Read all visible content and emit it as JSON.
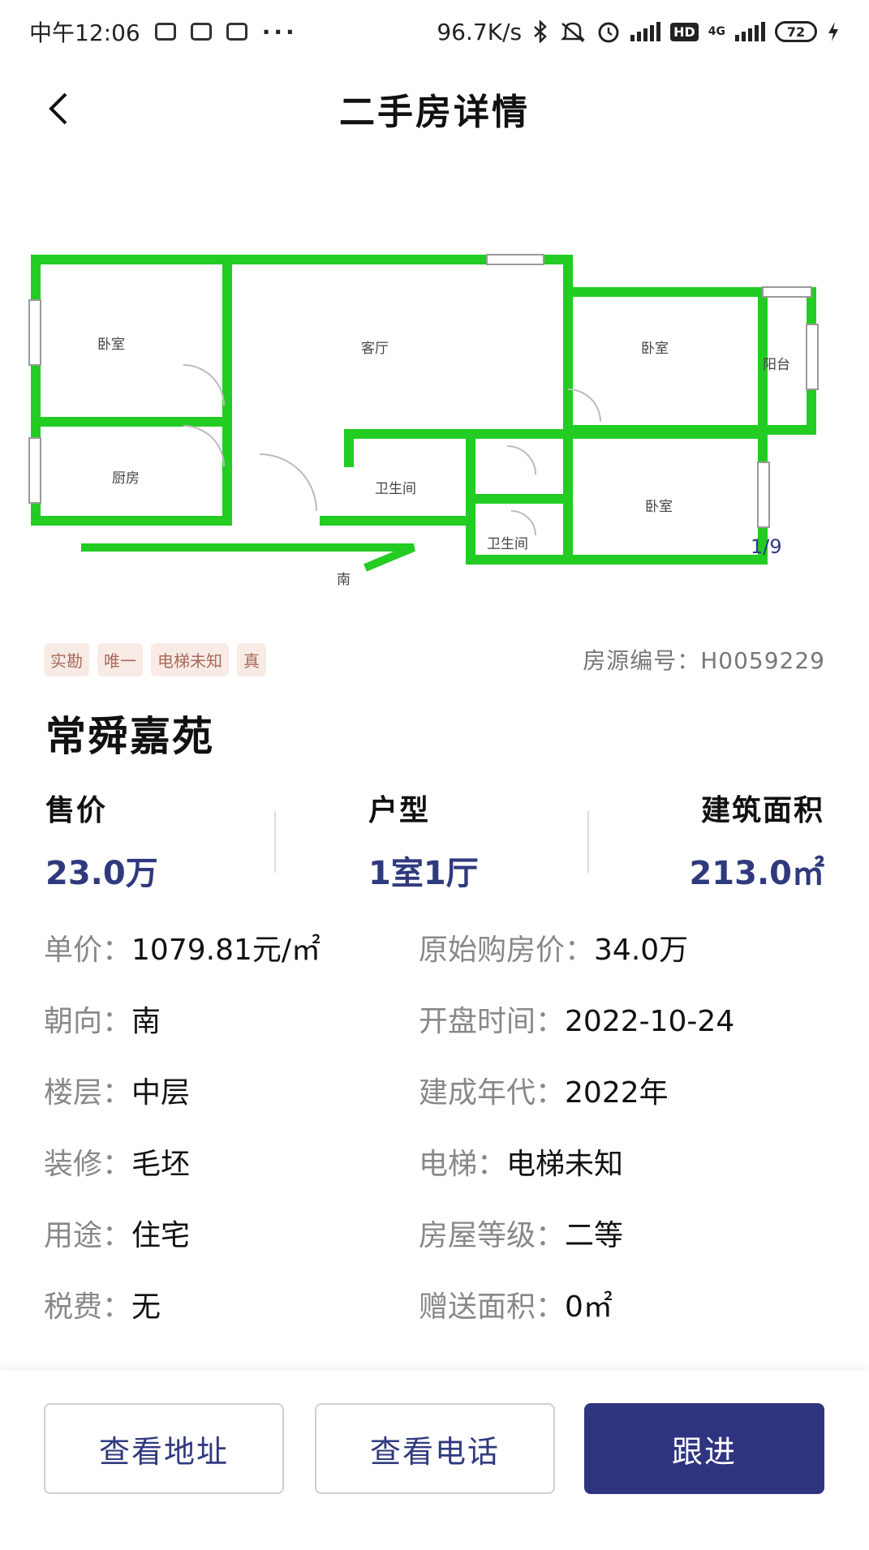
{
  "status_bar": {
    "time": "中午12:06",
    "more": "···",
    "net_speed": "96.7K/s",
    "hd": "HD",
    "network": "4G",
    "battery": "72"
  },
  "header": {
    "title": "二手房详情"
  },
  "photo": {
    "counter": "1/9",
    "floorplan_labels": {
      "bedroom1": "卧室",
      "living": "客厅",
      "bedroom2": "卧室",
      "balcony": "阳台",
      "kitchen": "厨房",
      "bath1": "卫生间",
      "bath2": "卫生间",
      "bedroom3": "卧室",
      "south": "南"
    },
    "plan_color": "#22cc22"
  },
  "tags": [
    "实勘",
    "唯一",
    "电梯未知",
    "真"
  ],
  "house_code": "房源编号：H0059229",
  "estate_name": "常舜嘉苑",
  "stats": {
    "price_label": "售价",
    "price_value": "23.0万",
    "layout_label": "户型",
    "layout_value": "1室1厅",
    "area_label": "建筑面积",
    "area_value": "213.0㎡"
  },
  "details": [
    {
      "lk": "单价：",
      "lv": "1079.81元/㎡",
      "rk": "原始购房价：",
      "rv": "34.0万"
    },
    {
      "lk": "朝向：",
      "lv": "南",
      "rk": "开盘时间：",
      "rv": "2022-10-24"
    },
    {
      "lk": "楼层：",
      "lv": "中层",
      "rk": "建成年代：",
      "rv": "2022年"
    },
    {
      "lk": "装修：",
      "lv": "毛坯",
      "rk": "电梯：",
      "rv": "电梯未知"
    },
    {
      "lk": "用途：",
      "lv": "住宅",
      "rk": "房屋等级：",
      "rv": "二等"
    },
    {
      "lk": "税费：",
      "lv": "无",
      "rk": "赠送面积：",
      "rv": "0㎡"
    }
  ],
  "actions": {
    "address": "查看地址",
    "phone": "查看电话",
    "follow": "跟进"
  },
  "colors": {
    "accent": "#2f3480",
    "value_text": "#2f3a7e"
  }
}
